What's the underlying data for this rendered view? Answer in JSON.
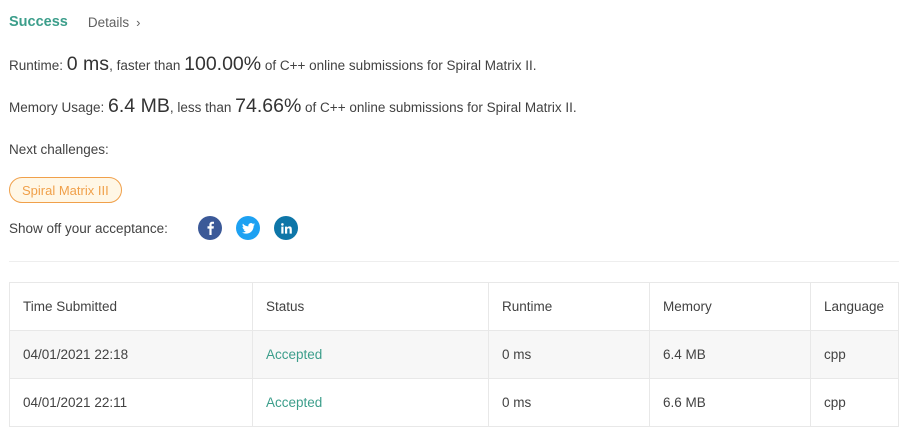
{
  "header": {
    "status": "Success",
    "details": "Details"
  },
  "runtime": {
    "label": "Runtime:",
    "value": "0 ms",
    "faster_text": ", faster than",
    "percent": "100.00%",
    "tail": "of C++ online submissions for Spiral Matrix II."
  },
  "memory": {
    "label": "Memory Usage:",
    "value": "6.4 MB",
    "less_text": ", less than",
    "percent": "74.66%",
    "tail": "of C++ online submissions for Spiral Matrix II."
  },
  "next": {
    "label": "Next challenges:",
    "challenge": "Spiral Matrix III"
  },
  "share": {
    "label": "Show off your acceptance:",
    "icons": [
      "facebook-icon",
      "twitter-icon",
      "linkedin-icon"
    ],
    "colors": {
      "facebook": "#3b5998",
      "twitter": "#1da1f2",
      "linkedin": "#0e76a8"
    }
  },
  "table": {
    "headers": [
      "Time Submitted",
      "Status",
      "Runtime",
      "Memory",
      "Language"
    ],
    "rows": [
      {
        "time": "04/01/2021 22:18",
        "status": "Accepted",
        "runtime": "0 ms",
        "memory": "6.4 MB",
        "language": "cpp"
      },
      {
        "time": "04/01/2021 22:11",
        "status": "Accepted",
        "runtime": "0 ms",
        "memory": "6.6 MB",
        "language": "cpp"
      }
    ]
  },
  "colors": {
    "success": "#3c9e8b",
    "challenge_border": "#f0a04a"
  }
}
